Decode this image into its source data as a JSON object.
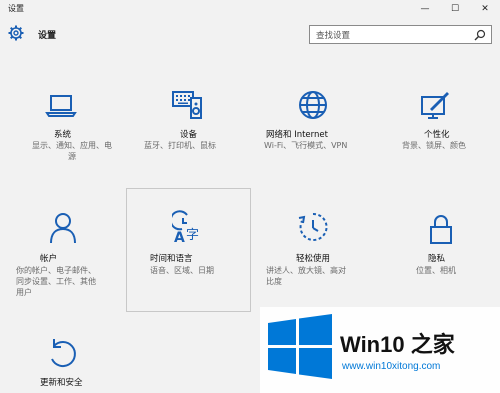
{
  "window": {
    "title": "设置",
    "minimize": "—",
    "maximize": "☐",
    "close": "✕"
  },
  "header": {
    "title": "设置",
    "search_placeholder": "查找设置"
  },
  "tiles": [
    {
      "name": "系统",
      "desc": "显示、通知、应用、电\n源",
      "icon": "laptop-icon"
    },
    {
      "name": "设备",
      "desc": "蓝牙、打印机、鼠标",
      "icon": "keyboard-speaker-icon"
    },
    {
      "name": "网络和 Internet",
      "desc": "Wi-Fi、飞行模式、VPN",
      "icon": "globe-icon"
    },
    {
      "name": "个性化",
      "desc": "背景、锁屏、颜色",
      "icon": "paint-brush-icon"
    },
    {
      "name": "帐户",
      "desc": "你的帐户、电子邮件、\n同步设置、工作、其他\n用户",
      "icon": "person-icon"
    },
    {
      "name": "时间和语言",
      "desc": "语音、区域、日期",
      "icon": "time-language-icon"
    },
    {
      "name": "轻松使用",
      "desc": "讲述人、放大镜、高对\n比度",
      "icon": "ease-of-access-icon"
    },
    {
      "name": "隐私",
      "desc": "位置、相机",
      "icon": "lock-icon"
    },
    {
      "name": "更新和安全",
      "desc": "",
      "icon": "refresh-icon"
    }
  ],
  "watermark": {
    "title": "Win10 之家",
    "url": "www.win10xitong.com"
  },
  "colors": {
    "accent": "#1a5fb4",
    "background": "#f2f2f2",
    "watermark_blue": "#0078d7"
  }
}
